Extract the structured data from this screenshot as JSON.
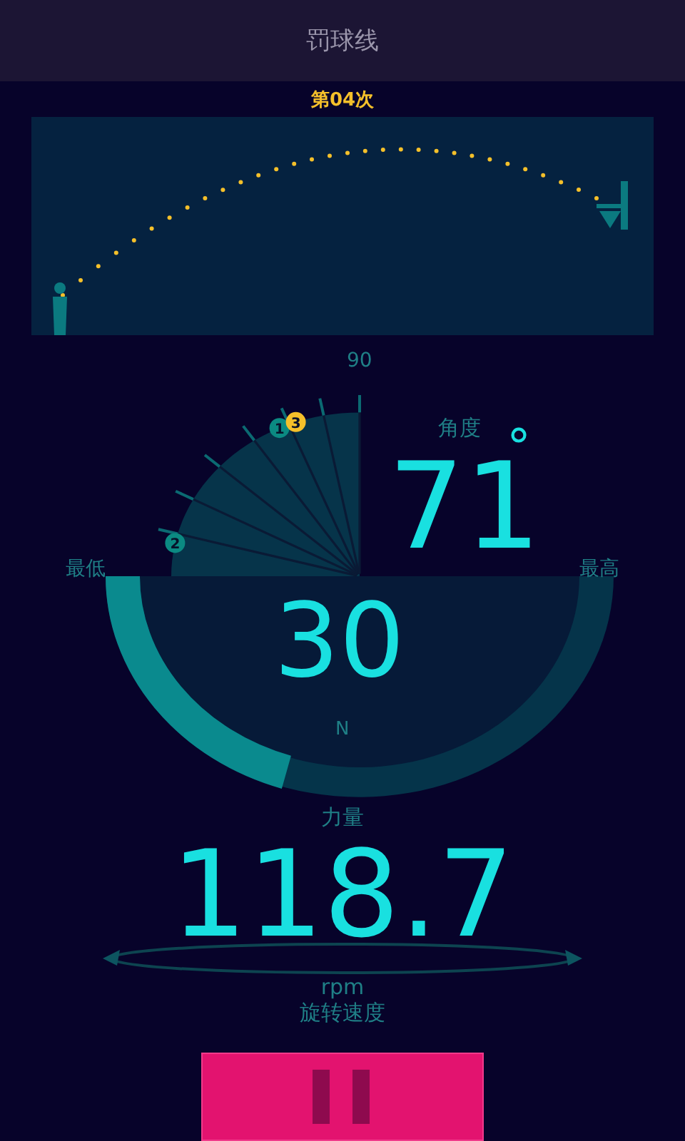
{
  "header": {
    "title": "罚球线"
  },
  "attempt": {
    "label": "第04次"
  },
  "angle": {
    "scale_max": "90",
    "label": "角度",
    "value": "71",
    "unit": "°",
    "min_label": "最低",
    "max_label": "最高",
    "markers": [
      {
        "label": "1",
        "selected": false
      },
      {
        "label": "2",
        "selected": false
      },
      {
        "label": "3",
        "selected": true
      }
    ]
  },
  "force": {
    "value": "30",
    "unit": "N",
    "label": "力量"
  },
  "spin": {
    "value": "118.7",
    "unit": "rpm",
    "label": "旋转速度"
  }
}
